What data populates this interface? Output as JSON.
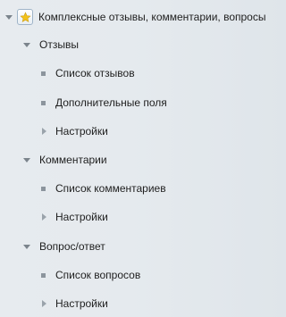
{
  "tree": {
    "root": {
      "label": "Комплексные отзывы, комментарии, вопросы",
      "icon": "star-icon",
      "icon_color": "#f2c21b"
    },
    "sections": [
      {
        "label": "Отзывы",
        "items": [
          {
            "label": "Список отзывов",
            "marker": "bullet"
          },
          {
            "label": "Дополнительные поля",
            "marker": "bullet"
          },
          {
            "label": "Настройки",
            "marker": "arrow"
          }
        ]
      },
      {
        "label": "Комментарии",
        "items": [
          {
            "label": "Список комментариев",
            "marker": "bullet"
          },
          {
            "label": "Настройки",
            "marker": "arrow"
          }
        ]
      },
      {
        "label": "Вопрос/ответ",
        "items": [
          {
            "label": "Список вопросов",
            "marker": "bullet"
          },
          {
            "label": "Настройки",
            "marker": "arrow"
          }
        ]
      }
    ]
  }
}
